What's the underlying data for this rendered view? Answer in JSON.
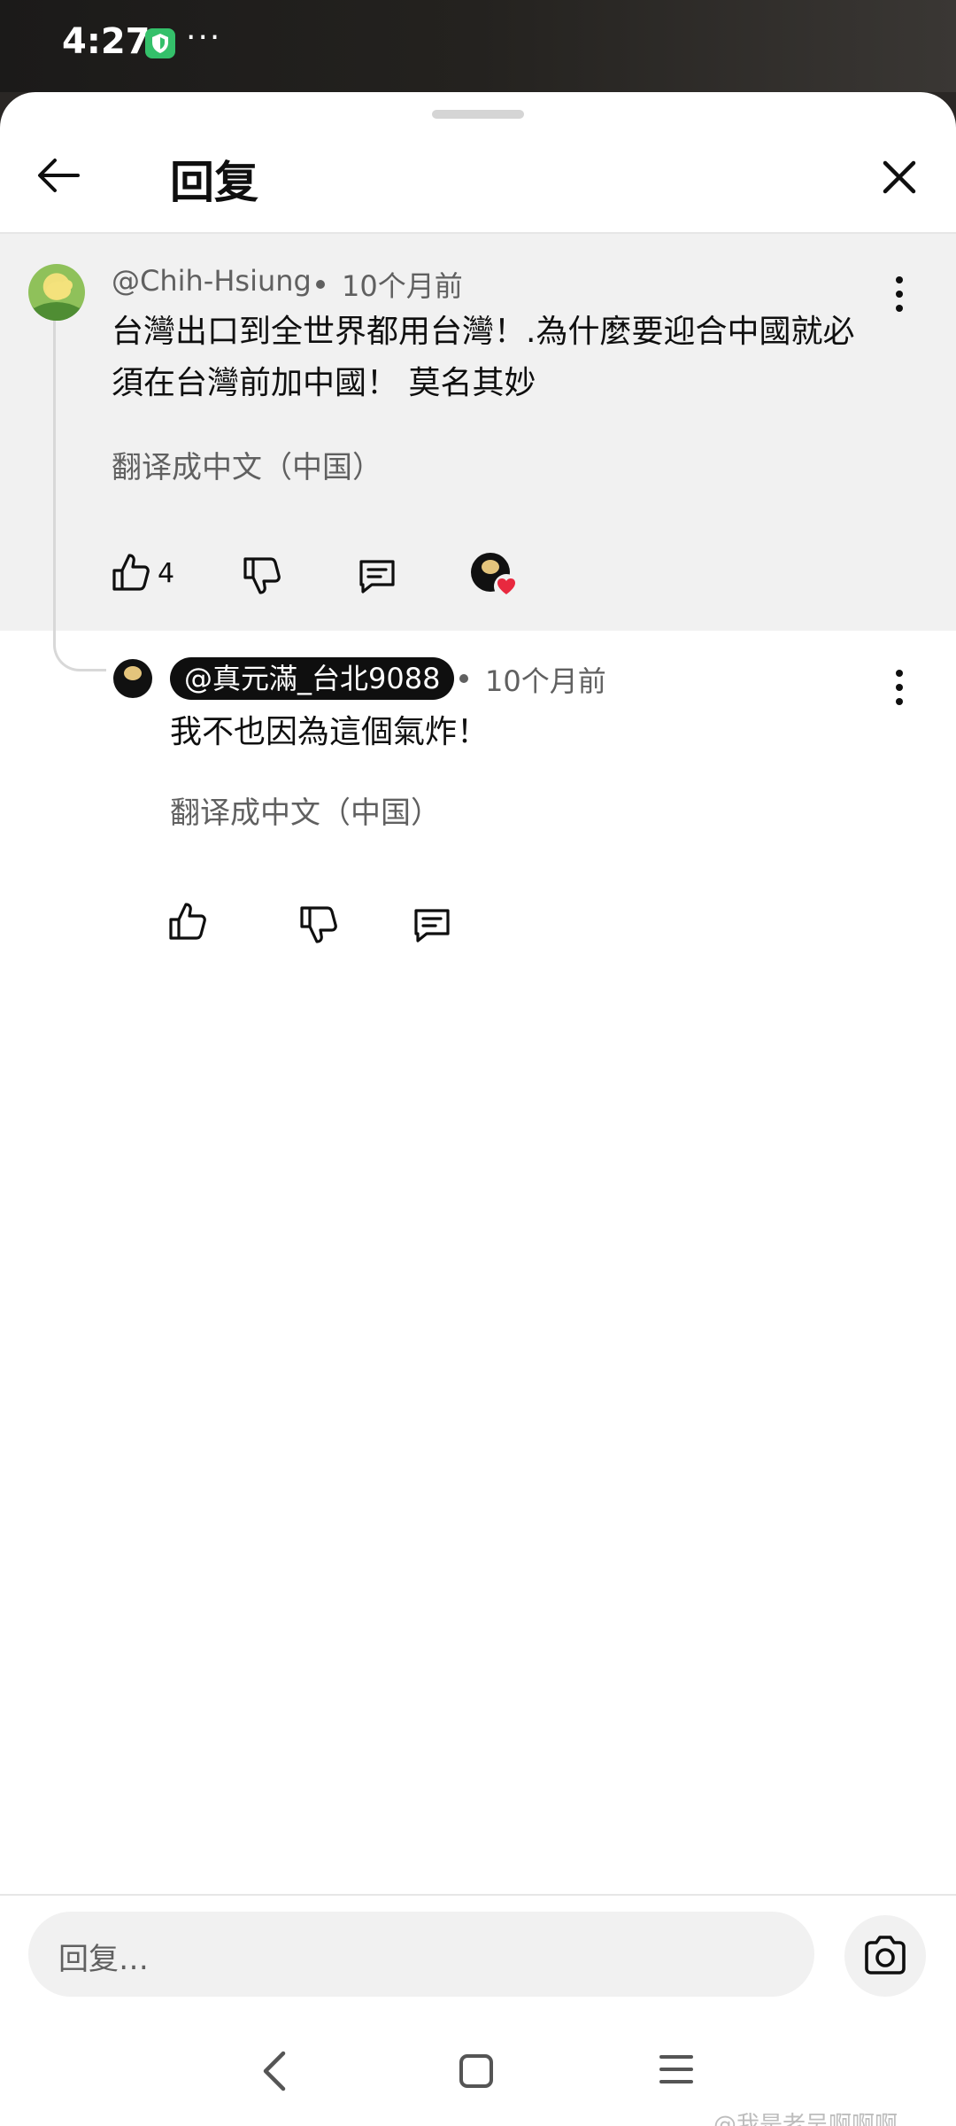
{
  "status_bar": {
    "time": "4:27",
    "overflow": "···",
    "icons": [
      "shield-icon"
    ]
  },
  "header": {
    "title": "回复",
    "back_icon": "arrow-left-icon",
    "close_icon": "close-icon"
  },
  "parent_comment": {
    "author": "@Chih-Hsiung",
    "time": "10个月前",
    "text_line1": "台灣出口到全世界都用台灣！.為什麼要迎合中國就必",
    "text_line2": "須在台灣前加中國！ 莫名其妙",
    "translate": "翻译成中文（中国）",
    "like_count": "4",
    "icons": [
      "thumbs-up-icon",
      "thumbs-down-icon",
      "reply-icon",
      "creator-heart-icon"
    ]
  },
  "reply": {
    "author": "@真元滿_台北9088",
    "time": "10个月前",
    "text": "我不也因為這個氣炸！",
    "translate": "翻译成中文（中国）"
  },
  "composer": {
    "placeholder": "回复…",
    "camera_icon": "camera-icon"
  },
  "nav_bar": {
    "icons": [
      "nav-back-icon",
      "nav-home-icon",
      "nav-recents-icon"
    ]
  },
  "watermark": "@我是老吴啊啊啊",
  "colors": {
    "background": "#ffffff",
    "parent_highlight": "#f1f1f1",
    "secondary_text": "#606060",
    "heart": "#e8293f",
    "shield": "#34c06a"
  }
}
